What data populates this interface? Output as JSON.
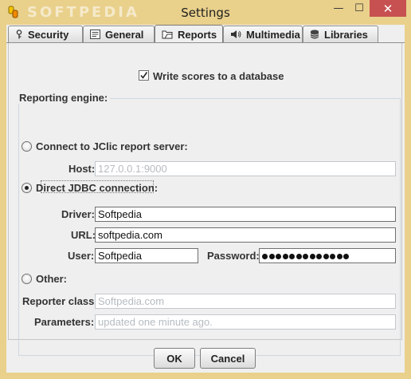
{
  "window": {
    "title": "Settings",
    "watermark": "SOFTPEDIA",
    "controls": {
      "minimize": "—",
      "maximize": "☐",
      "close": "✕"
    }
  },
  "tabs": [
    {
      "label": "Security",
      "icon": "key-icon"
    },
    {
      "label": "General",
      "icon": "settings-list-icon"
    },
    {
      "label": "Reports",
      "icon": "folder-icon"
    },
    {
      "label": "Multimedia",
      "icon": "speaker-icon"
    },
    {
      "label": "Libraries",
      "icon": "database-icon"
    }
  ],
  "active_tab": "Reports",
  "reports": {
    "write_scores_label": "Write scores to a database",
    "write_scores_checked": true,
    "group_title": "Reporting engine:",
    "connect_server_label": "Connect to JClic report server:",
    "host_label": "Host:",
    "host_value": "127.0.0.1:9000",
    "jdbc_label": "Direct JDBC connection:",
    "driver_label": "Driver:",
    "driver_value": "Softpedia",
    "url_label": "URL:",
    "url_value": "softpedia.com",
    "user_label": "User:",
    "user_value": "Softpedia",
    "password_label": "Password:",
    "password_length": 13,
    "other_label": "Other:",
    "reporter_class_label": "Reporter class:",
    "reporter_class_value": "Softpedia.com",
    "parameters_label": "Parameters:",
    "parameters_value": "updated one minute ago.",
    "selected_engine": "jdbc"
  },
  "buttons": {
    "ok": "OK",
    "cancel": "Cancel"
  },
  "colors": {
    "titlebar": "#e9d08b",
    "close_button": "#c75050",
    "disabled_text": "#b6bcc1"
  }
}
